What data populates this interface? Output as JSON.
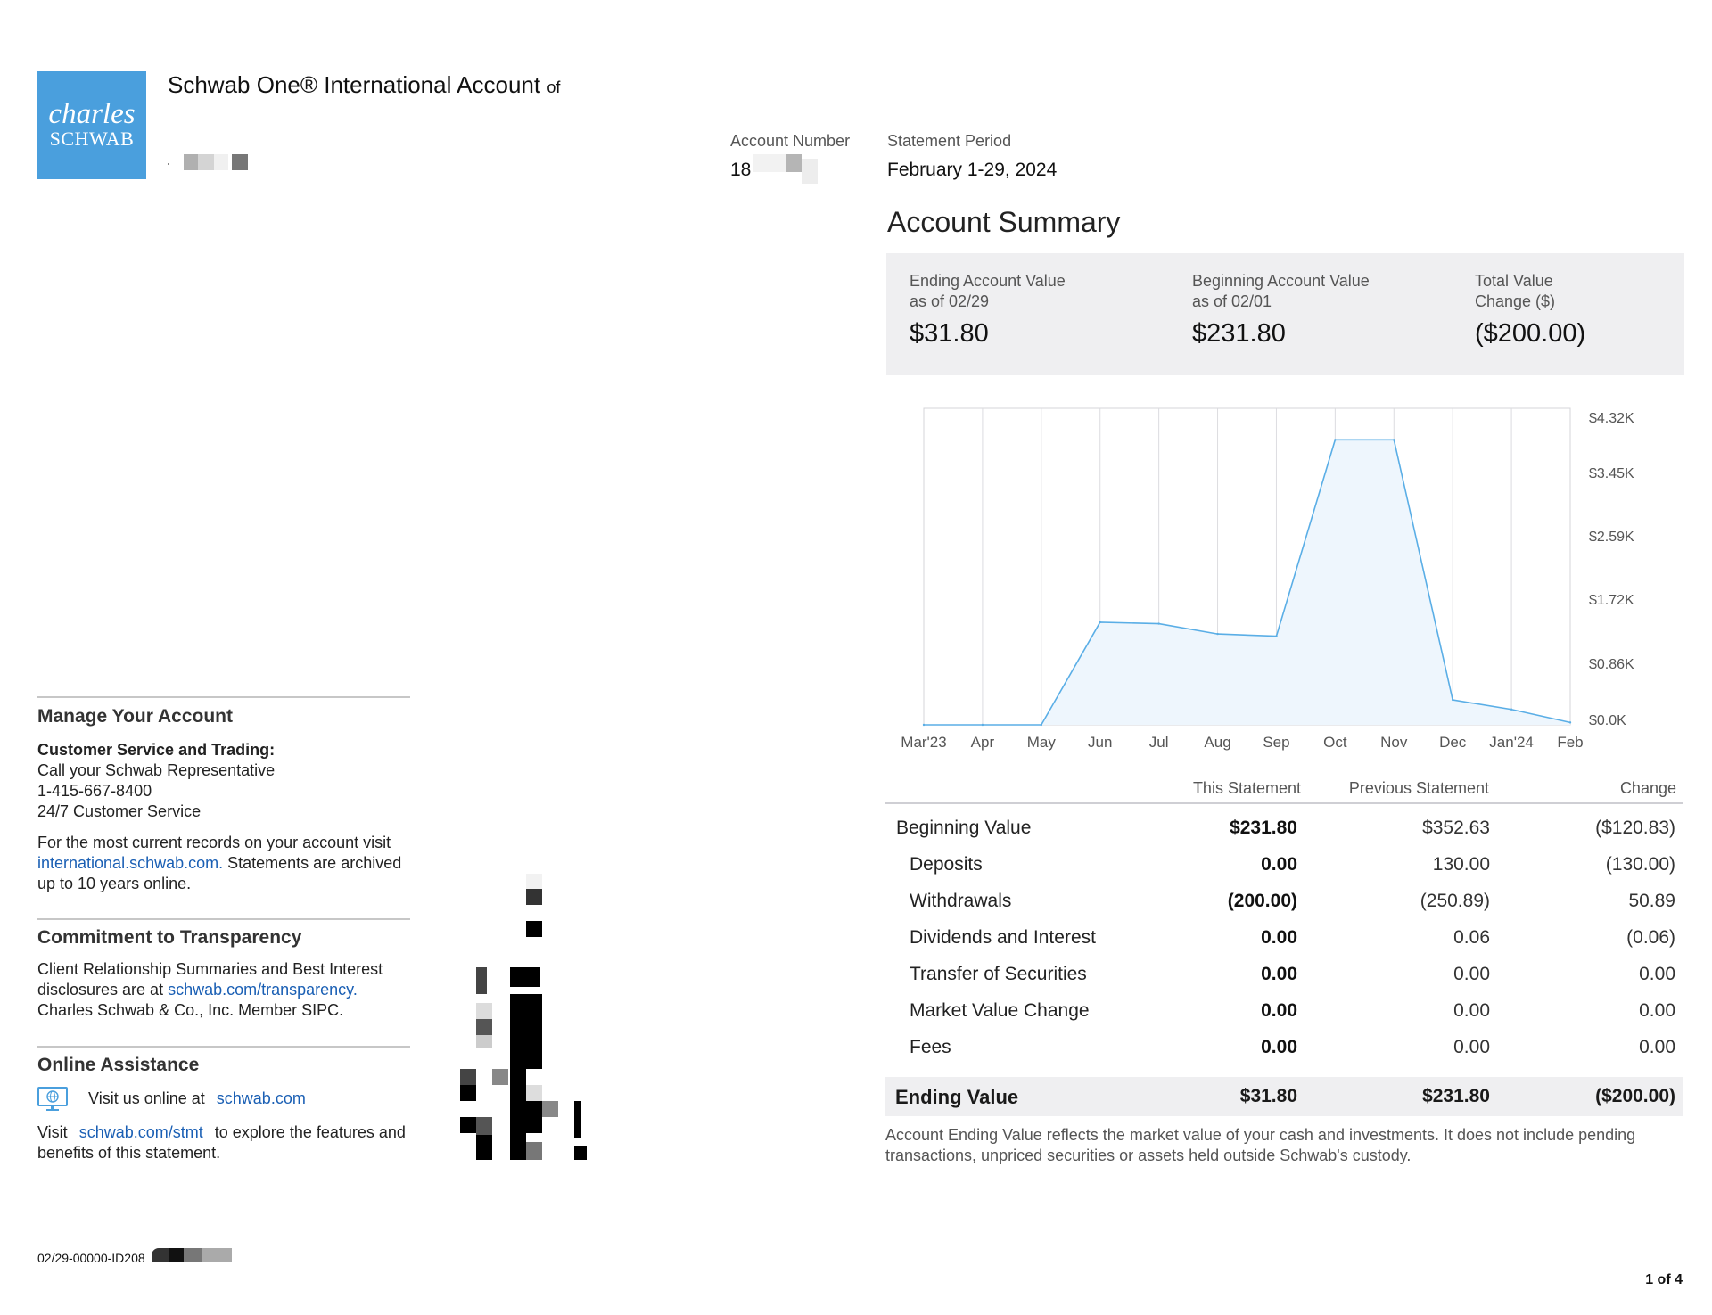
{
  "logo": {
    "line1": "charles",
    "line2": "SCHWAB"
  },
  "account_title": "Schwab One® International Account",
  "account_title_suffix": "of",
  "account_number": {
    "label": "Account Number",
    "value": "18"
  },
  "statement_period": {
    "label": "Statement Period",
    "value": "February 1-29, 2024"
  },
  "summary": {
    "title": "Account Summary",
    "ending": {
      "label1": "Ending Account Value",
      "label2": "as of 02/29",
      "value": "$31.80"
    },
    "beginning": {
      "label1": "Beginning Account Value",
      "label2": "as of 02/01",
      "value": "$231.80"
    },
    "change": {
      "label1": "Total Value",
      "label2": "Change ($)",
      "value": "($200.00)"
    }
  },
  "chart_data": {
    "type": "area",
    "categories": [
      "Mar'23",
      "Apr",
      "May",
      "Jun",
      "Jul",
      "Aug",
      "Sep",
      "Oct",
      "Nov",
      "Dec",
      "Jan'24",
      "Feb"
    ],
    "values": [
      0,
      0,
      0,
      1400,
      1380,
      1240,
      1210,
      3890,
      3890,
      340,
      210,
      31.8
    ],
    "y_ticks": [
      "$4.32K",
      "$3.45K",
      "$2.59K",
      "$1.72K",
      "$0.86K",
      "$0.0K"
    ],
    "ylim": [
      0,
      4320
    ],
    "y_axis_side": "right",
    "grid": "vertical",
    "fill_color": "#eef6fd",
    "line_color": "#5aaee6"
  },
  "table": {
    "headers": [
      "This Statement",
      "Previous Statement",
      "Change"
    ],
    "rows": [
      {
        "label": "Beginning Value",
        "this": "$231.80",
        "prev": "$352.63",
        "change": "($120.83)"
      },
      {
        "label": "Deposits",
        "this": "0.00",
        "prev": "130.00",
        "change": "(130.00)"
      },
      {
        "label": "Withdrawals",
        "this": "(200.00)",
        "prev": "(250.89)",
        "change": "50.89"
      },
      {
        "label": "Dividends and Interest",
        "this": "0.00",
        "prev": "0.06",
        "change": "(0.06)"
      },
      {
        "label": "Transfer of Securities",
        "this": "0.00",
        "prev": "0.00",
        "change": "0.00"
      },
      {
        "label": "Market Value Change",
        "this": "0.00",
        "prev": "0.00",
        "change": "0.00"
      },
      {
        "label": "Fees",
        "this": "0.00",
        "prev": "0.00",
        "change": "0.00"
      }
    ],
    "ending": {
      "label": "Ending Value",
      "this": "$31.80",
      "prev": "$231.80",
      "change": "($200.00)"
    },
    "footnote": "Account Ending Value reflects the market value of your cash and investments. It does not include pending transactions, unpriced securities or assets held outside Schwab's custody."
  },
  "manage": {
    "heading": "Manage Your Account",
    "cs_heading": "Customer Service and Trading:",
    "cs_line1": "Call your Schwab Representative",
    "cs_phone": "1-415-667-8400",
    "cs_line3": "24/7 Customer Service",
    "records_pre": "For the most current records on your account visit",
    "records_link": "international.schwab.com.",
    "records_post": "Statements are archived up to 10 years online."
  },
  "transparency": {
    "heading": "Commitment to Transparency",
    "text_pre": "Client Relationship Summaries and Best Interest disclosures are at",
    "link": "schwab.com/transparency.",
    "text_post": "Charles Schwab & Co., Inc. Member SIPC."
  },
  "online": {
    "heading": "Online Assistance",
    "visit_pre": "Visit us online at",
    "visit_link": "schwab.com",
    "stmt_pre": "Visit",
    "stmt_link": "schwab.com/stmt",
    "stmt_post": "to explore the features and benefits of this statement.",
    "icon": "monitor-globe-icon"
  },
  "doc_id": "02/29-00000-ID208",
  "page_number": "1 of 4"
}
